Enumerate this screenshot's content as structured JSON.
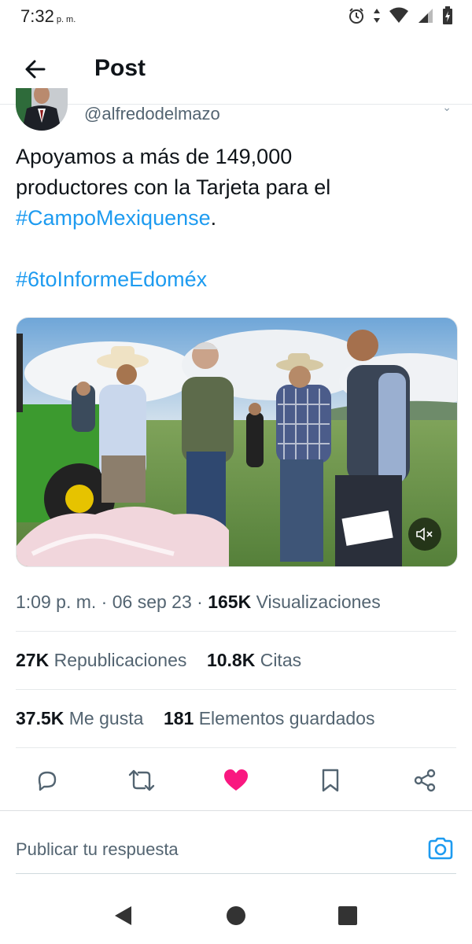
{
  "status_bar": {
    "time": "7:32",
    "ampm": "p. m.",
    "icons": [
      "alarm-icon",
      "data-arrows-icon",
      "wifi-icon",
      "signal-icon",
      "battery-icon"
    ]
  },
  "header": {
    "title": "Post",
    "back_icon": "arrow-left-icon"
  },
  "author": {
    "handle": "@alfredodelmazo"
  },
  "tweet": {
    "line1": "Apoyamos a más de 149,000",
    "line2": "productores con la Tarjeta para el",
    "hashtag1": "#CampoMexiquense",
    "period": ".",
    "hashtag2": "#6toInformeEdoméx"
  },
  "media": {
    "mute_icon": "volume-muted-icon"
  },
  "meta": {
    "time": "1:09 p. m.",
    "separator": "·",
    "date": "06 sep 23",
    "views_count": "165K",
    "views_label": "Visualizaciones"
  },
  "stats": {
    "reposts_count": "27K",
    "reposts_label": "Republicaciones",
    "quotes_count": "10.8K",
    "quotes_label": "Citas",
    "likes_count": "37.5K",
    "likes_label": "Me gusta",
    "bookmarks_count": "181",
    "bookmarks_label": "Elementos guardados"
  },
  "actions": [
    "reply-icon",
    "repost-icon",
    "like-icon",
    "bookmark-icon",
    "share-icon"
  ],
  "reply": {
    "placeholder": "Publicar tu respuesta",
    "camera_icon": "camera-icon"
  },
  "colors": {
    "accent": "#1d9bf0",
    "like": "#f91880",
    "text_secondary": "#536471"
  }
}
